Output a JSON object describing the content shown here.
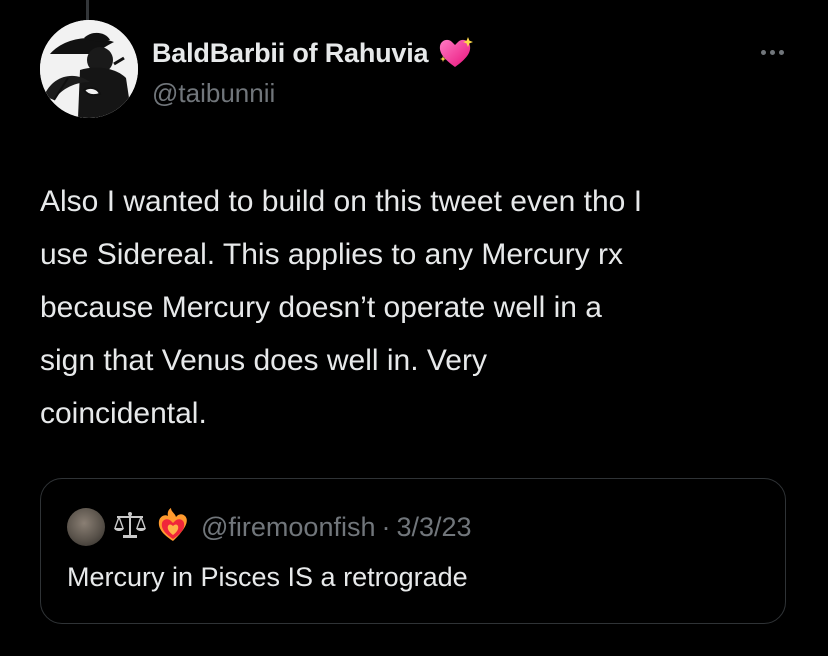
{
  "author": {
    "display_name": "BaldBarbii of Rahuvia",
    "handle": "@taibunnii",
    "name_emoji": "sparkling-heart-icon"
  },
  "tweet": {
    "text": "Also I wanted to build on this tweet even tho I\nuse Sidereal. This applies to any Mercury rx\nbecause Mercury doesn’t operate well in a\nsign that Venus does well in. Very\ncoincidental."
  },
  "quoted_tweet": {
    "name_emojis": [
      "balance-scale-icon",
      "heart-on-fire-icon"
    ],
    "handle": "@firemoonfish",
    "separator": "·",
    "date": "3/3/23",
    "text": "Mercury in Pisces IS a retrograde"
  },
  "colors": {
    "background": "#000000",
    "primary_text": "#e7e9ea",
    "secondary_text": "#71767b",
    "border": "#2f3336",
    "heart_pink": "#ff3d9a"
  }
}
